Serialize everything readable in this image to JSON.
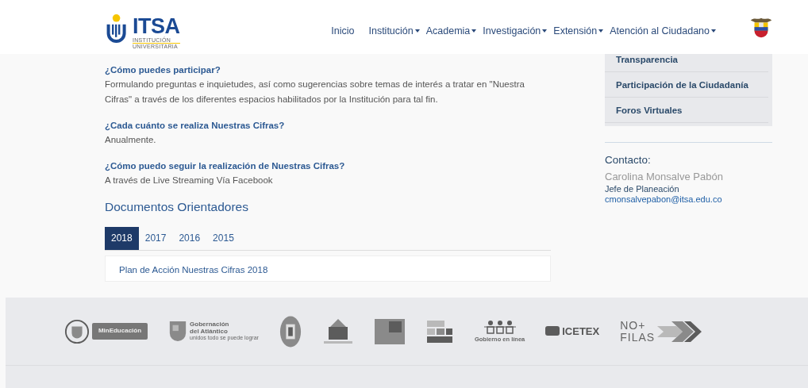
{
  "header": {
    "logo": {
      "name": "ITSA",
      "line1": "INSTITUCIÓN",
      "line2": "UNIVERSITARIA"
    },
    "nav": [
      {
        "label": "Inicio",
        "dropdown": false
      },
      {
        "label": "Institución",
        "dropdown": true
      },
      {
        "label": "Academia",
        "dropdown": true
      },
      {
        "label": "Investigación",
        "dropdown": true
      },
      {
        "label": "Extensión",
        "dropdown": true
      },
      {
        "label": "Atención al Ciudadano",
        "dropdown": true
      }
    ]
  },
  "faq": [
    {
      "question": "¿Cómo puedes participar?",
      "answer": "Formulando preguntas e inquietudes, así como sugerencias sobre temas de interés a tratar en \"Nuestra Cifras\" a través de los diferentes espacios habilitados por la Institución para tal fin."
    },
    {
      "question": "¿Cada cuánto se realiza Nuestras Cifras?",
      "answer": "Anualmente."
    },
    {
      "question": "¿Cómo puedo seguir la realización de Nuestras Cifras?",
      "answer": "A través de Live Streaming Vía Facebook"
    }
  ],
  "documents": {
    "title": "Documentos Orientadores",
    "tabs": [
      {
        "label": "2018",
        "selected": true
      },
      {
        "label": "2017",
        "selected": false
      },
      {
        "label": "2016",
        "selected": false
      },
      {
        "label": "2015",
        "selected": false
      }
    ],
    "items": [
      "Plan de Acción Nuestras Cifras 2018"
    ]
  },
  "dropdown_menu": [
    "Transparencia",
    "Participación de la Ciudadanía",
    "Foros Virtuales"
  ],
  "contact": {
    "title": "Contacto:",
    "name": "Carolina Monsalve Pabón",
    "role": "Jefe de Planeación",
    "email": "cmonsalvepabon@itsa.edu.co"
  },
  "footer": {
    "logos": [
      {
        "kind": "seal-wordmark",
        "texts": [
          "MinEducación"
        ]
      },
      {
        "kind": "crest-wordmark",
        "texts": [
          "Gobernación",
          "del Atlántico",
          "unidos todo se puede lograr"
        ]
      },
      {
        "kind": "round-seal"
      },
      {
        "kind": "building"
      },
      {
        "kind": "photo-card"
      },
      {
        "kind": "block-grid"
      },
      {
        "kind": "figures",
        "texts": [
          "Gobierno en línea"
        ]
      },
      {
        "kind": "wordmark",
        "texts": [
          "ICETEX"
        ]
      },
      {
        "kind": "arrows",
        "texts": [
          "NO+",
          "FILAS"
        ]
      }
    ]
  }
}
